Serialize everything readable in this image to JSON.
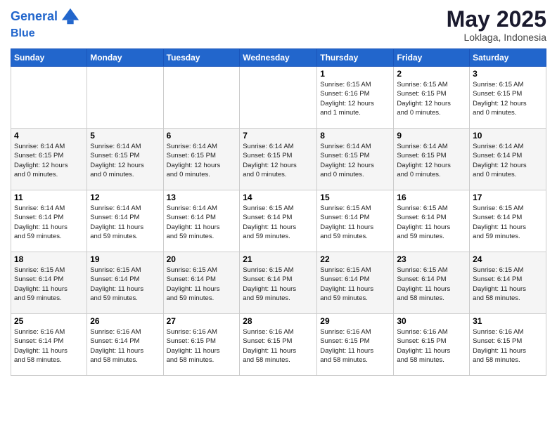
{
  "logo": {
    "line1": "General",
    "line2": "Blue"
  },
  "title": "May 2025",
  "location": "Loklaga, Indonesia",
  "days_of_week": [
    "Sunday",
    "Monday",
    "Tuesday",
    "Wednesday",
    "Thursday",
    "Friday",
    "Saturday"
  ],
  "weeks": [
    [
      {
        "day": "",
        "info": ""
      },
      {
        "day": "",
        "info": ""
      },
      {
        "day": "",
        "info": ""
      },
      {
        "day": "",
        "info": ""
      },
      {
        "day": "1",
        "info": "Sunrise: 6:15 AM\nSunset: 6:16 PM\nDaylight: 12 hours\nand 1 minute."
      },
      {
        "day": "2",
        "info": "Sunrise: 6:15 AM\nSunset: 6:15 PM\nDaylight: 12 hours\nand 0 minutes."
      },
      {
        "day": "3",
        "info": "Sunrise: 6:15 AM\nSunset: 6:15 PM\nDaylight: 12 hours\nand 0 minutes."
      }
    ],
    [
      {
        "day": "4",
        "info": "Sunrise: 6:14 AM\nSunset: 6:15 PM\nDaylight: 12 hours\nand 0 minutes."
      },
      {
        "day": "5",
        "info": "Sunrise: 6:14 AM\nSunset: 6:15 PM\nDaylight: 12 hours\nand 0 minutes."
      },
      {
        "day": "6",
        "info": "Sunrise: 6:14 AM\nSunset: 6:15 PM\nDaylight: 12 hours\nand 0 minutes."
      },
      {
        "day": "7",
        "info": "Sunrise: 6:14 AM\nSunset: 6:15 PM\nDaylight: 12 hours\nand 0 minutes."
      },
      {
        "day": "8",
        "info": "Sunrise: 6:14 AM\nSunset: 6:15 PM\nDaylight: 12 hours\nand 0 minutes."
      },
      {
        "day": "9",
        "info": "Sunrise: 6:14 AM\nSunset: 6:15 PM\nDaylight: 12 hours\nand 0 minutes."
      },
      {
        "day": "10",
        "info": "Sunrise: 6:14 AM\nSunset: 6:14 PM\nDaylight: 12 hours\nand 0 minutes."
      }
    ],
    [
      {
        "day": "11",
        "info": "Sunrise: 6:14 AM\nSunset: 6:14 PM\nDaylight: 11 hours\nand 59 minutes."
      },
      {
        "day": "12",
        "info": "Sunrise: 6:14 AM\nSunset: 6:14 PM\nDaylight: 11 hours\nand 59 minutes."
      },
      {
        "day": "13",
        "info": "Sunrise: 6:14 AM\nSunset: 6:14 PM\nDaylight: 11 hours\nand 59 minutes."
      },
      {
        "day": "14",
        "info": "Sunrise: 6:15 AM\nSunset: 6:14 PM\nDaylight: 11 hours\nand 59 minutes."
      },
      {
        "day": "15",
        "info": "Sunrise: 6:15 AM\nSunset: 6:14 PM\nDaylight: 11 hours\nand 59 minutes."
      },
      {
        "day": "16",
        "info": "Sunrise: 6:15 AM\nSunset: 6:14 PM\nDaylight: 11 hours\nand 59 minutes."
      },
      {
        "day": "17",
        "info": "Sunrise: 6:15 AM\nSunset: 6:14 PM\nDaylight: 11 hours\nand 59 minutes."
      }
    ],
    [
      {
        "day": "18",
        "info": "Sunrise: 6:15 AM\nSunset: 6:14 PM\nDaylight: 11 hours\nand 59 minutes."
      },
      {
        "day": "19",
        "info": "Sunrise: 6:15 AM\nSunset: 6:14 PM\nDaylight: 11 hours\nand 59 minutes."
      },
      {
        "day": "20",
        "info": "Sunrise: 6:15 AM\nSunset: 6:14 PM\nDaylight: 11 hours\nand 59 minutes."
      },
      {
        "day": "21",
        "info": "Sunrise: 6:15 AM\nSunset: 6:14 PM\nDaylight: 11 hours\nand 59 minutes."
      },
      {
        "day": "22",
        "info": "Sunrise: 6:15 AM\nSunset: 6:14 PM\nDaylight: 11 hours\nand 59 minutes."
      },
      {
        "day": "23",
        "info": "Sunrise: 6:15 AM\nSunset: 6:14 PM\nDaylight: 11 hours\nand 58 minutes."
      },
      {
        "day": "24",
        "info": "Sunrise: 6:15 AM\nSunset: 6:14 PM\nDaylight: 11 hours\nand 58 minutes."
      }
    ],
    [
      {
        "day": "25",
        "info": "Sunrise: 6:16 AM\nSunset: 6:14 PM\nDaylight: 11 hours\nand 58 minutes."
      },
      {
        "day": "26",
        "info": "Sunrise: 6:16 AM\nSunset: 6:14 PM\nDaylight: 11 hours\nand 58 minutes."
      },
      {
        "day": "27",
        "info": "Sunrise: 6:16 AM\nSunset: 6:15 PM\nDaylight: 11 hours\nand 58 minutes."
      },
      {
        "day": "28",
        "info": "Sunrise: 6:16 AM\nSunset: 6:15 PM\nDaylight: 11 hours\nand 58 minutes."
      },
      {
        "day": "29",
        "info": "Sunrise: 6:16 AM\nSunset: 6:15 PM\nDaylight: 11 hours\nand 58 minutes."
      },
      {
        "day": "30",
        "info": "Sunrise: 6:16 AM\nSunset: 6:15 PM\nDaylight: 11 hours\nand 58 minutes."
      },
      {
        "day": "31",
        "info": "Sunrise: 6:16 AM\nSunset: 6:15 PM\nDaylight: 11 hours\nand 58 minutes."
      }
    ]
  ]
}
